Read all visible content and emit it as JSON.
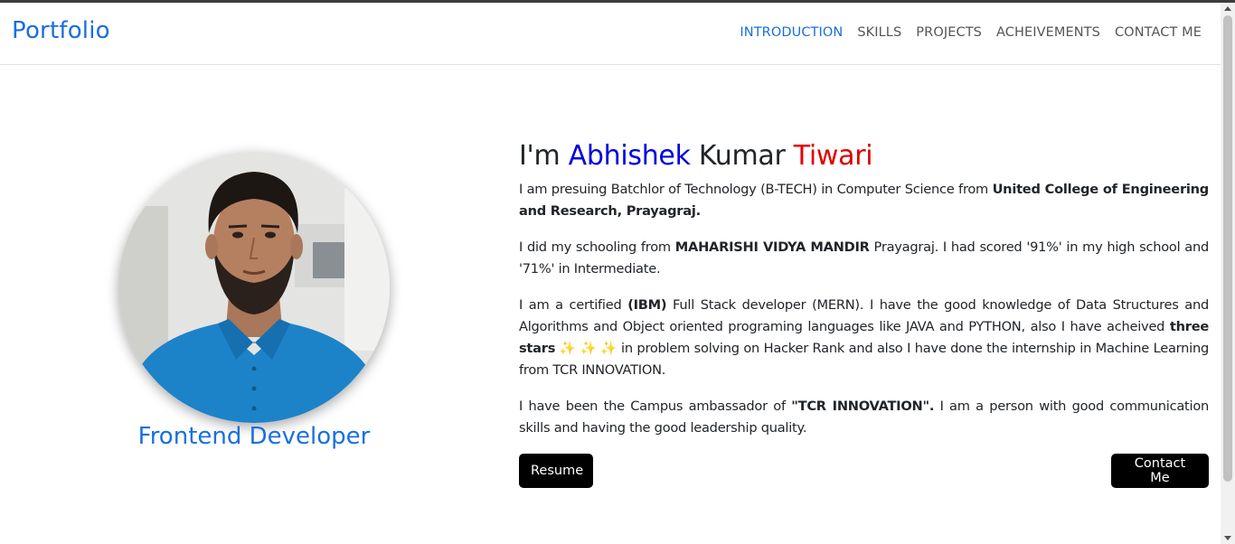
{
  "navbar": {
    "brand": "Portfolio",
    "links": [
      {
        "label": "INTRODUCTION",
        "active": true
      },
      {
        "label": "SKILLS",
        "active": false
      },
      {
        "label": "PROJECTS",
        "active": false
      },
      {
        "label": "ACHEIVEMENTS",
        "active": false
      },
      {
        "label": "CONTACT ME",
        "active": false
      }
    ]
  },
  "profile": {
    "role": "Frontend Developer"
  },
  "intro": {
    "heading_prefix": "I'm ",
    "first_name": "Abhishek",
    "middle_name": " Kumar ",
    "last_name": "Tiwari",
    "p1_text": "I am presuing Batchlor of Technology (B-TECH) in Computer Science from ",
    "p1_bold": "United College of Engineering and Research, Prayagraj.",
    "p2_text_a": "I did my schooling from ",
    "p2_bold": "MAHARISHI VIDYA MANDIR",
    "p2_text_b": " Prayagraj. I had scored '91%' in my high school and '71%' in Intermediate.",
    "p3_text_a": "I am a certified ",
    "p3_bold_a": "(IBM)",
    "p3_text_b": " Full Stack developer (MERN). I have the good knowledge of Data Structures and Algorithms and Object oriented programing languages like JAVA and PYTHON, also I have acheived ",
    "p3_bold_b": "three stars",
    "p3_sparkles": " ✨ ✨ ✨ ",
    "p3_text_c": " in problem solving on Hacker Rank and also I have done the internship in Machine Learning from TCR INNOVATION.",
    "p4_text_a": "I have been the Campus ambassador of ",
    "p4_bold": "\"TCR INNOVATION\".",
    "p4_text_b": " I am a person with good communication skills and having the good leadership quality."
  },
  "buttons": {
    "resume": "Resume",
    "contact": "Contact Me"
  },
  "colors": {
    "brand_blue": "#1a6fdf",
    "first_name": "#0000e0",
    "last_name": "#e00000",
    "button_bg": "#000000"
  }
}
